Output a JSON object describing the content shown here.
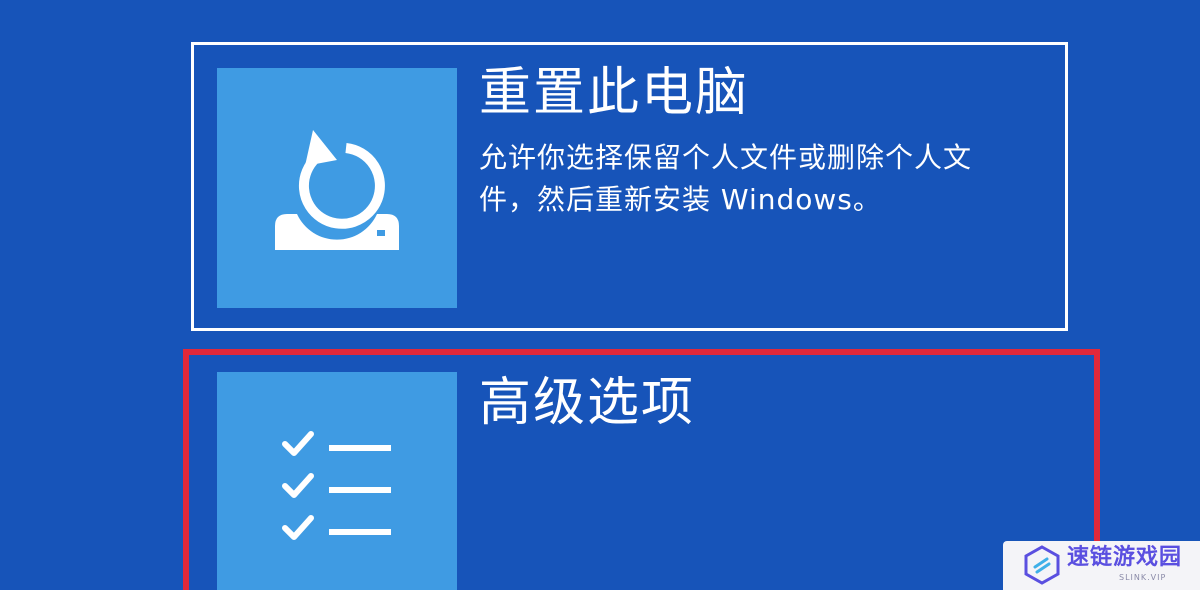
{
  "options": {
    "reset": {
      "title": "重置此电脑",
      "description": "允许你选择保留个人文件或删除个人文件，然后重新安装 Windows。",
      "icon": "reset-pc-icon"
    },
    "advanced": {
      "title": "高级选项",
      "icon": "checklist-icon"
    }
  },
  "watermark": {
    "name": "速链游戏园",
    "subtitle": "SLINK.VIP"
  },
  "colors": {
    "background": "#1754b9",
    "tile": "#3f9be3",
    "highlight": "#e0283a",
    "text": "#ffffff"
  }
}
